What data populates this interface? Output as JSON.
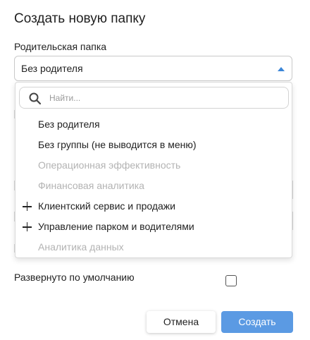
{
  "dialog": {
    "title": "Создать новую папку",
    "parent_label": "Родительская папка",
    "parent_value": "Без родителя",
    "search": {
      "placeholder": "Найти..."
    },
    "options": [
      {
        "label": "Без родителя",
        "enabled": true,
        "expandable": false
      },
      {
        "label": "Без группы (не выводится в меню)",
        "enabled": true,
        "expandable": false
      },
      {
        "label": "Операционная эффективность",
        "enabled": false,
        "expandable": false
      },
      {
        "label": "Финансовая аналитика",
        "enabled": false,
        "expandable": false
      },
      {
        "label": "Клиентский сервис и продажи",
        "enabled": true,
        "expandable": true
      },
      {
        "label": "Управление парком и водителями",
        "enabled": true,
        "expandable": true
      },
      {
        "label": "Аналитика данных",
        "enabled": false,
        "expandable": false
      }
    ],
    "expanded_by_default_label": "Развернуто по умолчанию",
    "expanded_by_default": false,
    "cancel_label": "Отмена",
    "create_label": "Создать"
  },
  "colors": {
    "accent": "#3b86d8",
    "primary_button": "#5b9ae3",
    "disabled_text": "#b3b3b3"
  },
  "icons": {
    "search": "search-icon",
    "caret": "caret-up-icon",
    "expand": "plus-icon"
  }
}
